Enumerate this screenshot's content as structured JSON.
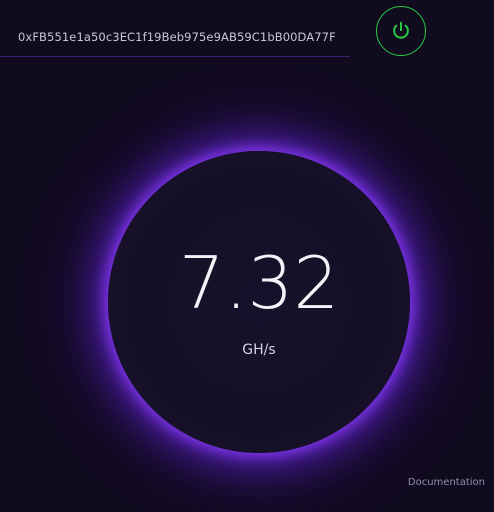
{
  "wallet": {
    "address": "0xFB551e1a50c3EC1f19Beb975e9AB59C1bB00DA77F"
  },
  "power": {
    "icon": "power-icon",
    "color": "#28c940"
  },
  "gauge": {
    "value": "7.32",
    "unit": "GH/s",
    "glow_color": "#7a2ee8"
  },
  "footer": {
    "documentation_label": "Documentation"
  }
}
